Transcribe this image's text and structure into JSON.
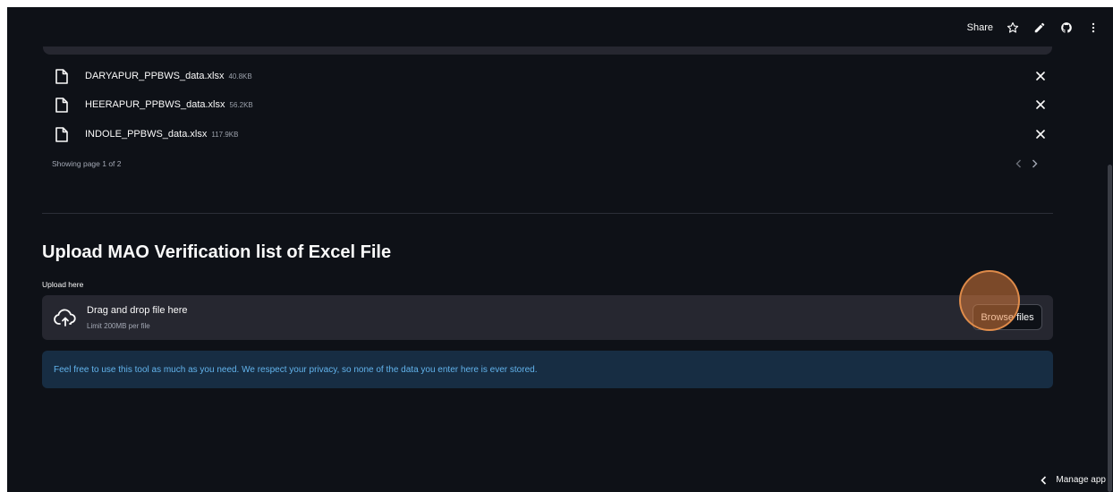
{
  "toolbar": {
    "share_label": "Share",
    "icons": [
      "star-icon",
      "edit-icon",
      "github-icon",
      "more-vertical-icon"
    ]
  },
  "files": [
    {
      "name": "DARYAPUR_PPBWS_data.xlsx",
      "size": "40.8KB"
    },
    {
      "name": "HEERAPUR_PPBWS_data.xlsx",
      "size": "56.2KB"
    },
    {
      "name": "INDOLE_PPBWS_data.xlsx",
      "size": "117.9KB"
    }
  ],
  "pagination": {
    "label": "Showing page 1 of 2",
    "prev_glyph": "‹",
    "next_glyph": "›"
  },
  "upload": {
    "title": "Upload MAO Verification list of Excel File",
    "label": "Upload here",
    "drop_text": "Drag and drop file here",
    "limit_text": "Limit 200MB per file",
    "browse_label": "Browse files"
  },
  "info": {
    "text": "Feel free to use this tool as much as you need. We respect your privacy, so none of the data you enter here is ever stored."
  },
  "footer": {
    "manage_label": "Manage app"
  },
  "colors": {
    "background": "#0e1117",
    "panel": "#262730",
    "info_bg": "#172d43",
    "info_text": "#62b3ec",
    "highlight": "#e8823c"
  }
}
